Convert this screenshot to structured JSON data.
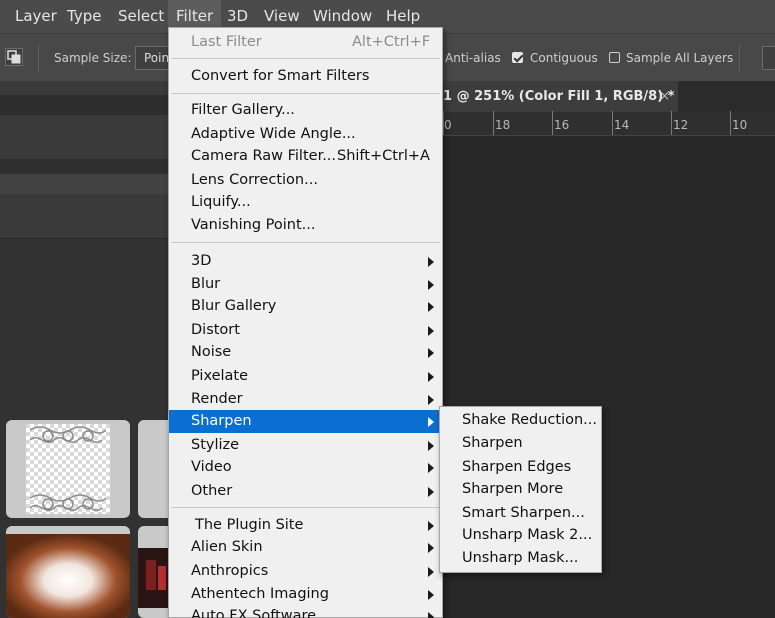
{
  "menubar": {
    "items": [
      "Layer",
      "Type",
      "Select",
      "Filter",
      "3D",
      "View",
      "Window",
      "Help"
    ]
  },
  "options_bar": {
    "sample_size_label": "Sample Size:",
    "sample_size_value": "Poin",
    "anti_alias_label": "Anti-alias",
    "contiguous_label": "Contiguous",
    "sample_all_layers_label": "Sample All Layers"
  },
  "document": {
    "tab_title": "1 @ 251% (Color Fill 1, RGB/8) *",
    "close_glyph": "×",
    "ruler_labels": [
      "0",
      "18",
      "16",
      "14",
      "12",
      "10"
    ]
  },
  "filter_menu": {
    "last_filter": {
      "label": "Last Filter",
      "shortcut": "Alt+Ctrl+F",
      "enabled": false
    },
    "convert": "Convert for Smart Filters",
    "group1": [
      {
        "label": "Filter Gallery..."
      },
      {
        "label": "Adaptive Wide Angle..."
      },
      {
        "label": "Camera Raw Filter...",
        "shortcut": "Shift+Ctrl+A"
      },
      {
        "label": "Lens Correction..."
      },
      {
        "label": "Liquify..."
      },
      {
        "label": "Vanishing Point..."
      }
    ],
    "group2": [
      "3D",
      "Blur",
      "Blur Gallery",
      "Distort",
      "Noise",
      "Pixelate",
      "Render",
      "Sharpen",
      "Stylize",
      "Video",
      "Other"
    ],
    "group3": [
      "The Plugin Site",
      "Alien Skin",
      "Anthropics",
      "Athentech Imaging",
      "Auto FX Software"
    ],
    "highlighted": "Sharpen"
  },
  "sharpen_submenu": {
    "items": [
      "Shake Reduction...",
      "Sharpen",
      "Sharpen Edges",
      "Sharpen More",
      "Smart Sharpen...",
      "Unsharp Mask 2...",
      "Unsharp Mask..."
    ]
  },
  "colors": {
    "highlight": "#0b6fd1",
    "menu_bg": "#f0f0f0",
    "ui_dark": "#282828"
  }
}
